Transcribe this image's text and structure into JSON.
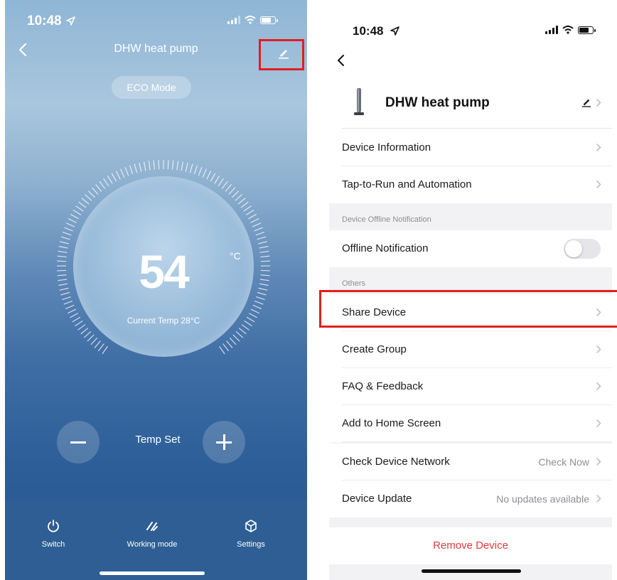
{
  "left_screen": {
    "status_time": "10:48",
    "title": "DHW heat pump",
    "mode_badge": "ECO Mode",
    "temperature": "54",
    "unit": "°C",
    "current_temp": "Current Temp 28°C",
    "temp_set_label": "Temp Set",
    "tabs": [
      {
        "label": "Switch",
        "icon": "power-icon"
      },
      {
        "label": "Working mode",
        "icon": "working-mode-icon"
      },
      {
        "label": "Settings",
        "icon": "cube-icon"
      }
    ],
    "colors": {
      "highlight": "#e41e1e"
    }
  },
  "right_screen": {
    "status_time": "10:48",
    "device_name": "DHW heat pump",
    "rows": {
      "device_information": "Device Information",
      "tap_to_run": "Tap-to-Run and Automation",
      "offline_notification_section": "Device Offline Notification",
      "offline_notification": "Offline Notification",
      "others_section": "Others",
      "share_device": "Share Device",
      "create_group": "Create Group",
      "faq": "FAQ & Feedback",
      "add_home": "Add to Home Screen",
      "check_network": "Check Device Network",
      "check_network_value": "Check Now",
      "device_update": "Device Update",
      "device_update_value": "No updates available"
    },
    "offline_toggle_on": false,
    "remove_label": "Remove Device",
    "colors": {
      "remove": "#e03a3a",
      "highlight": "#e41e1e"
    }
  }
}
